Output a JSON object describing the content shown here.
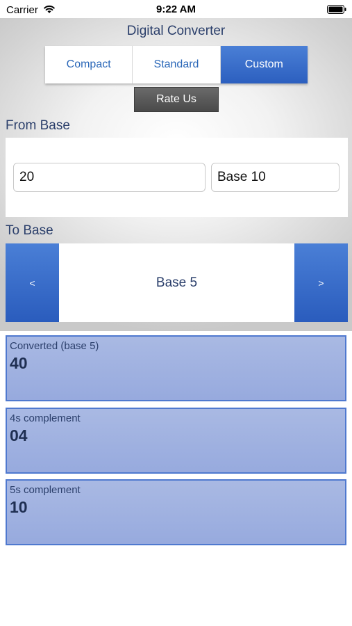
{
  "status_bar": {
    "carrier": "Carrier",
    "time": "9:22 AM",
    "icons": [
      "wifi-icon",
      "battery-icon"
    ]
  },
  "header": {
    "title": "Digital Converter"
  },
  "mode_tabs": {
    "items": [
      {
        "label": "Compact",
        "selected": false
      },
      {
        "label": "Standard",
        "selected": false
      },
      {
        "label": "Custom",
        "selected": true
      }
    ]
  },
  "rate_us": {
    "label": "Rate Us"
  },
  "from_base": {
    "label": "From Base",
    "value": "20",
    "base": "Base 10"
  },
  "to_base": {
    "label": "To Base",
    "prev_label": "<",
    "next_label": ">",
    "value": "Base 5"
  },
  "results": [
    {
      "label": "Converted (base 5)",
      "value": "40"
    },
    {
      "label": "4s complement",
      "value": "04"
    },
    {
      "label": "5s complement",
      "value": "10"
    }
  ],
  "colors": {
    "accent_blue": "#2c5fbf",
    "text_navy": "#2b3f6b",
    "result_fill": "#a3b4e1",
    "result_border": "#4f79cf",
    "rate_button": "#555555"
  }
}
